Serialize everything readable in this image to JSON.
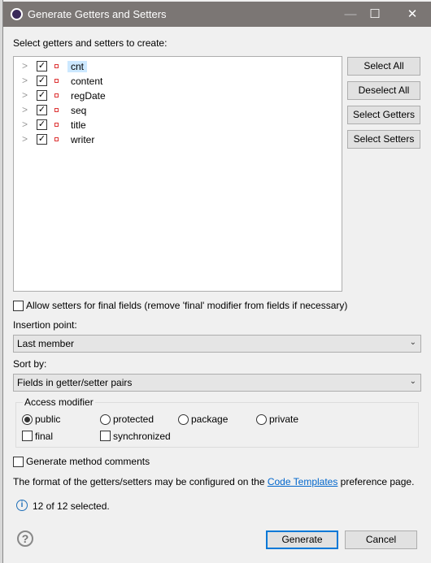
{
  "window": {
    "title": "Generate Getters and Setters",
    "minimize": "—",
    "maximize": "☐",
    "close": "✕"
  },
  "tree": {
    "label": "Select getters and setters to create:",
    "fields": [
      "cnt",
      "content",
      "regDate",
      "seq",
      "title",
      "writer"
    ],
    "selected_index": 0
  },
  "side_buttons": {
    "select_all": "Select All",
    "deselect_all": "Deselect All",
    "select_getters": "Select Getters",
    "select_setters": "Select Setters"
  },
  "allow_final": {
    "label": "Allow setters for final fields (remove 'final' modifier from fields if necessary)",
    "checked": false
  },
  "insertion": {
    "label": "Insertion point:",
    "value": "Last member"
  },
  "sort": {
    "label": "Sort by:",
    "value": "Fields in getter/setter pairs"
  },
  "access": {
    "label": "Access modifier",
    "options": [
      "public",
      "protected",
      "package",
      "private"
    ],
    "selected": "public",
    "final": "final",
    "synchronized": "synchronized"
  },
  "comments": {
    "label": "Generate method comments",
    "checked": false
  },
  "info": {
    "before": "The format of the getters/setters may be configured on the ",
    "link": "Code Templates",
    "after": " preference page."
  },
  "status": "12 of 12 selected.",
  "footer": {
    "generate": "Generate",
    "cancel": "Cancel",
    "help": "?"
  },
  "colors": {
    "titlebar": "#7b7674",
    "accent": "#0078d7",
    "link": "#0066cc"
  }
}
